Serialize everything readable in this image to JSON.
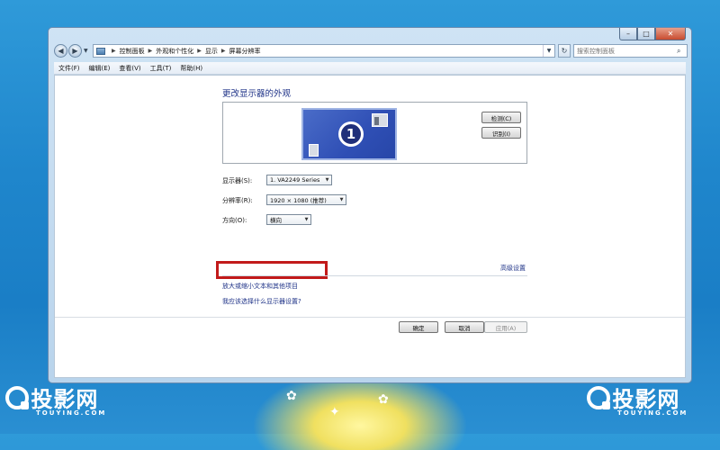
{
  "window": {
    "controls": {
      "minimize": "–",
      "maximize": "□",
      "close": "✕"
    }
  },
  "nav": {
    "back": "◀",
    "forward": "▶",
    "breadcrumbs": [
      "控制面板",
      "外观和个性化",
      "显示",
      "屏幕分辨率"
    ],
    "separator": "▶",
    "search_placeholder": "搜索控制面板"
  },
  "menu": {
    "items": [
      "文件(F)",
      "编辑(E)",
      "查看(V)",
      "工具(T)",
      "帮助(H)"
    ]
  },
  "main": {
    "heading": "更改显示器的外观",
    "monitor_number": "1",
    "detect_button": "检测(C)",
    "identify_button": "识别(I)",
    "display_label": "显示器(S):",
    "display_value": "1. VA2249 Series",
    "resolution_label": "分辨率(R):",
    "resolution_value": "1920 × 1080 (推荐)",
    "orientation_label": "方向(O):",
    "orientation_value": "横向",
    "advanced_link": "高级设置",
    "enlarge_link": "放大或缩小文本和其他项目",
    "choose_link": "我应该选择什么显示器设置?",
    "ok_button": "确定",
    "cancel_button": "取消",
    "apply_button": "应用(A)"
  },
  "watermark": {
    "text": "投影网",
    "sub": "TOUYING.COM"
  },
  "colors": {
    "highlight_box": "#c21a1a",
    "link": "#1e3287",
    "monitor_blue": "#2f4fb5"
  }
}
